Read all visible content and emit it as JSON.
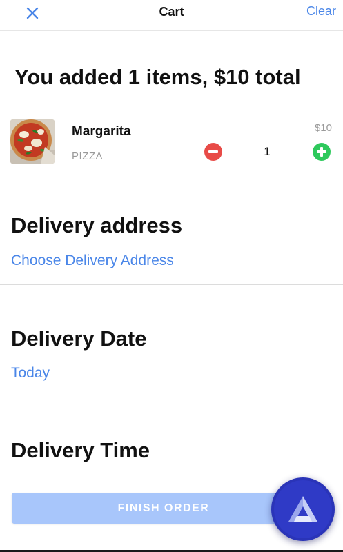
{
  "header": {
    "title": "Cart",
    "clear_label": "Clear"
  },
  "summary": {
    "text": "You added 1 items, $10 total"
  },
  "cart": {
    "items": [
      {
        "name": "Margarita",
        "category": "PIZZA",
        "price": "$10",
        "quantity": "1"
      }
    ]
  },
  "delivery_address": {
    "heading": "Delivery address",
    "link": "Choose Delivery Address"
  },
  "delivery_date": {
    "heading": "Delivery Date",
    "link": "Today"
  },
  "delivery_time": {
    "heading": "Delivery Time"
  },
  "footer": {
    "finish_label": "FINISH ORDER"
  },
  "colors": {
    "accent_blue": "#4a86e8",
    "minus_red": "#e84b47",
    "plus_green": "#2ec95c",
    "finish_button": "#a8c6fb",
    "fab": "#2f3ac6"
  },
  "icons": {
    "close": "close-icon",
    "minus": "minus-circle-icon",
    "plus": "plus-circle-icon",
    "fab": "app-logo-icon"
  }
}
